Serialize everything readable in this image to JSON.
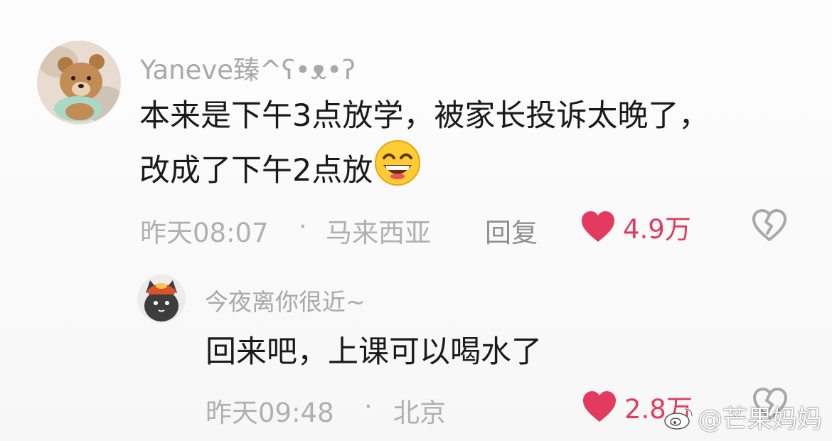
{
  "colors": {
    "like_red": "#e33a60",
    "meta_gray": "#b0b0b0",
    "text_dark": "#1a1a1a"
  },
  "comments": [
    {
      "avatar_icon": "teddy-bear-avatar",
      "username": "Yaneve臻^ʕ•ᴥ•ʔ",
      "text_line1": "本来是下午3点放学，被家长投诉太晚了，",
      "text_line2": "改成了下午2点放",
      "emoji": "grinning-face-emoji",
      "time": "昨天08:07",
      "separator": "·",
      "location": "马来西亚",
      "reply_label": "回复",
      "likes": "4.9万"
    },
    {
      "avatar_icon": "cartoon-cat-avatar",
      "username": "今夜离你很近~",
      "text": "回来吧，上课可以喝水了",
      "time": "昨天09:48",
      "separator": "·",
      "location": "北京",
      "likes": "2.8万"
    }
  ],
  "watermark": {
    "icon": "weibo-logo-icon",
    "text": "@芒果妈妈"
  }
}
